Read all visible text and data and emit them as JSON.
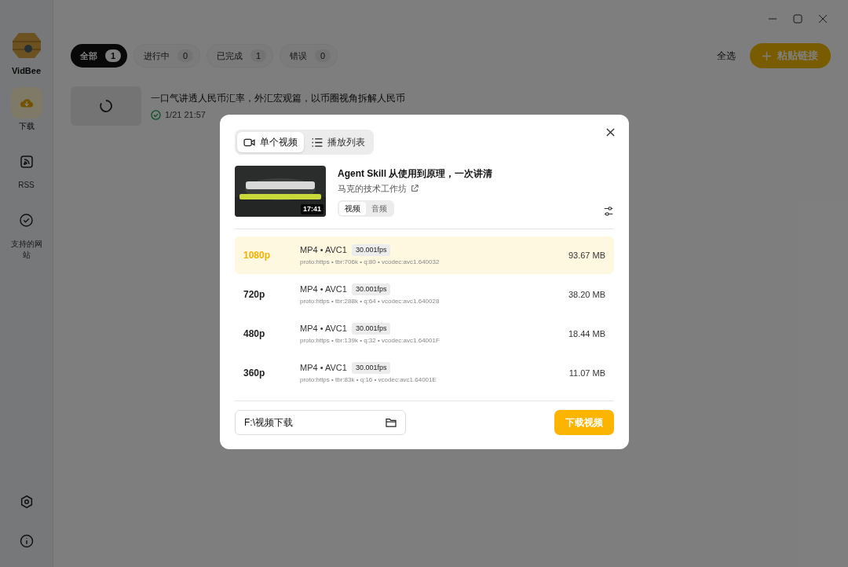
{
  "app": {
    "name": "VidBee"
  },
  "sidebar": {
    "items": [
      {
        "label": "下载",
        "kind": "download",
        "selected": true
      },
      {
        "label": "RSS",
        "kind": "rss",
        "selected": false
      },
      {
        "label": "支持的网站",
        "kind": "sites",
        "selected": false
      }
    ]
  },
  "filter_tabs": [
    {
      "label": "全部",
      "count": "1",
      "selected": true
    },
    {
      "label": "进行中",
      "count": "0",
      "selected": false
    },
    {
      "label": "已完成",
      "count": "1",
      "selected": false
    },
    {
      "label": "错误",
      "count": "0",
      "selected": false
    }
  ],
  "toolbar": {
    "select_all": "全选",
    "paste_button": "粘贴链接"
  },
  "downloads": [
    {
      "title": "一口气讲透人民币汇率，外汇宏观篇，以币圈视角拆解人民币",
      "completed": true,
      "time": "1/21 21:57"
    }
  ],
  "dialog": {
    "tabs": [
      {
        "label": "单个视频",
        "kind": "video",
        "selected": true
      },
      {
        "label": "播放列表",
        "kind": "list",
        "selected": false
      }
    ],
    "video": {
      "title": "Agent Skill 从使用到原理，一次讲清",
      "channel": "马克的技术工作坊",
      "duration": "17:41"
    },
    "type_toggle": [
      {
        "label": "视频",
        "selected": true
      },
      {
        "label": "音频",
        "selected": false
      }
    ],
    "formats": [
      {
        "resolution": "1080p",
        "container": "MP4 • AVC1",
        "fps": "30.001fps",
        "details": "proto:https • tbr:706k • q:80 • vcodec:avc1.640032",
        "size": "93.67 MB",
        "selected": true
      },
      {
        "resolution": "720p",
        "container": "MP4 • AVC1",
        "fps": "30.001fps",
        "details": "proto:https • tbr:288k • q:64 • vcodec:avc1.640028",
        "size": "38.20 MB",
        "selected": false
      },
      {
        "resolution": "480p",
        "container": "MP4 • AVC1",
        "fps": "30.001fps",
        "details": "proto:https • tbr:139k • q:32 • vcodec:avc1.64001F",
        "size": "18.44 MB",
        "selected": false
      },
      {
        "resolution": "360p",
        "container": "MP4 • AVC1",
        "fps": "30.001fps",
        "details": "proto:https • tbr:83k • q:16 • vcodec:avc1.64001E",
        "size": "11.07 MB",
        "selected": false
      }
    ],
    "save_path": "F:\\视频下载",
    "download_button": "下载视频"
  }
}
